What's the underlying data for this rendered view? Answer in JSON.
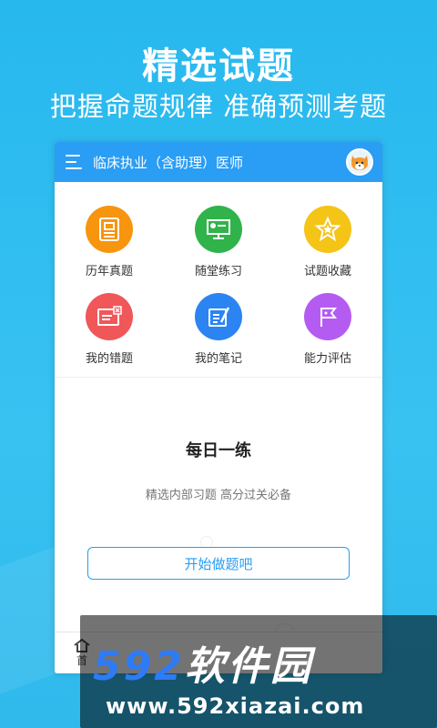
{
  "banner": {
    "headline": "精选试题",
    "subline": "把握命题规律  准确预测考题"
  },
  "app_bar": {
    "title": "临床执业（含助理）医师",
    "avatar_icon": "fox-avatar-icon"
  },
  "grid": [
    {
      "label": "历年真题",
      "color": "#f7950f",
      "icon": "exam-paper-icon"
    },
    {
      "label": "随堂练习",
      "color": "#31b34b",
      "icon": "classroom-screen-icon"
    },
    {
      "label": "试题收藏",
      "color": "#f4c417",
      "icon": "star-icon"
    },
    {
      "label": "我的错题",
      "color": "#f05759",
      "icon": "error-card-icon"
    },
    {
      "label": "我的笔记",
      "color": "#2b84f2",
      "icon": "notebook-pen-icon"
    },
    {
      "label": "能力评估",
      "color": "#b45cf1",
      "icon": "flag-icon"
    }
  ],
  "daily": {
    "title": "每日一练",
    "subtitle": "精选内部习题  高分过关必备",
    "button": "开始做题吧"
  },
  "bottom_nav": {
    "home_label": "首"
  },
  "watermark": {
    "num": "592",
    "cn": "软件园",
    "url": "www.592xiazai.com"
  }
}
